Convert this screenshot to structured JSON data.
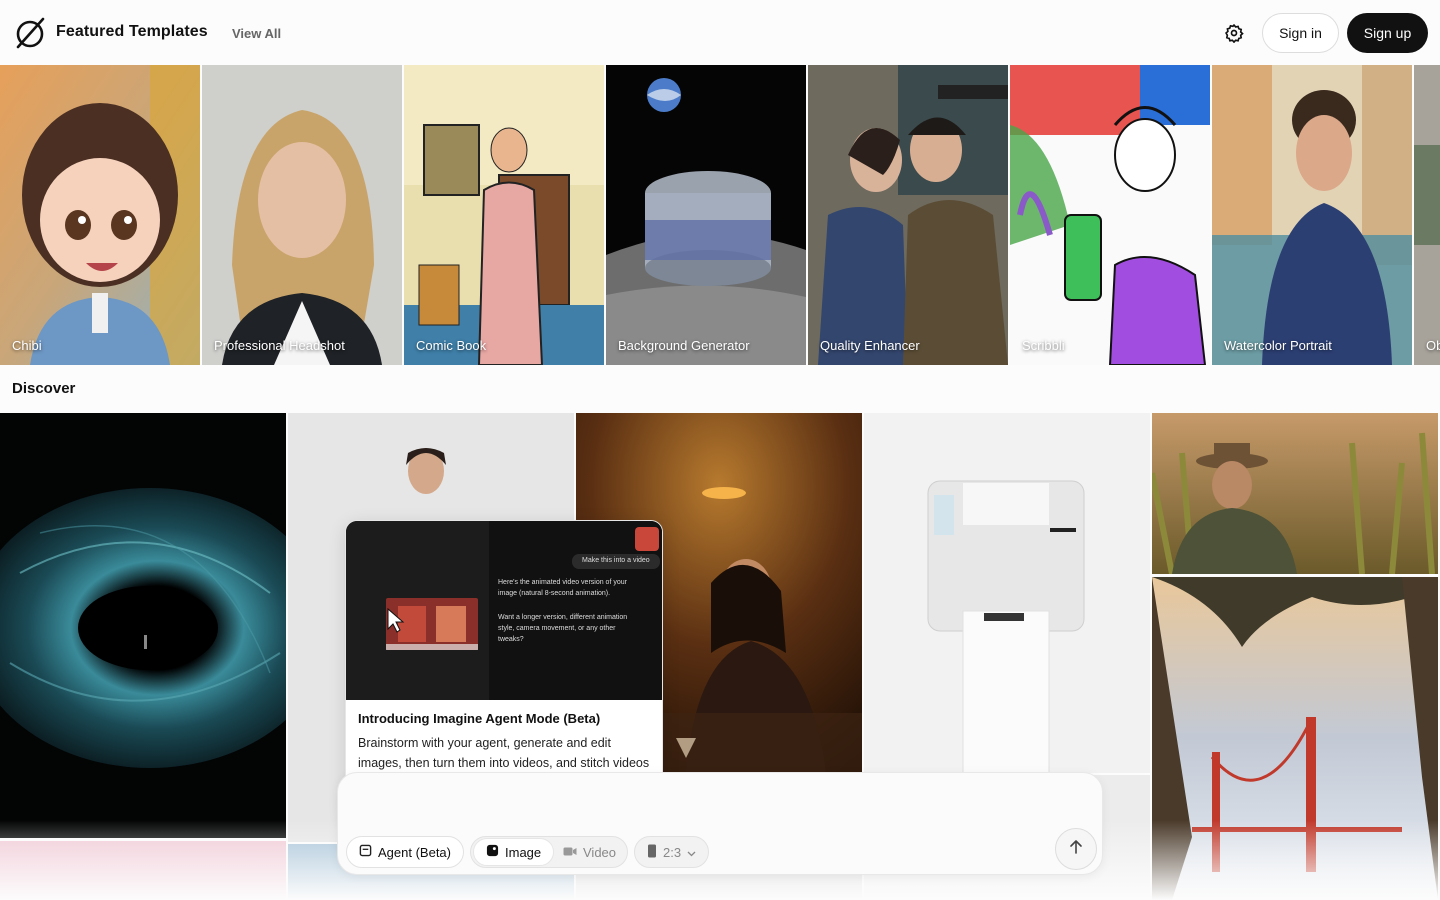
{
  "header": {
    "title": "Featured Templates",
    "view_all": "View All",
    "sign_in": "Sign in",
    "sign_up": "Sign up"
  },
  "templates": [
    {
      "label": "Chibi"
    },
    {
      "label": "Professional Headshot"
    },
    {
      "label": "Comic Book"
    },
    {
      "label": "Background Generator"
    },
    {
      "label": "Quality Enhancer"
    },
    {
      "label": "Scribbli"
    },
    {
      "label": "Watercolor Portrait"
    },
    {
      "label": "Ob"
    }
  ],
  "discover": {
    "heading": "Discover"
  },
  "promo": {
    "title": "Introducing Imagine Agent Mode (Beta)",
    "body": "Brainstorm with your agent, generate and edit images, then turn them into videos, and stitch videos together to create longer videos all in one place.",
    "chat_user": "Make this into a video",
    "chat_reply_1": "Here's the animated video version of your image (natural 8-second animation).",
    "chat_reply_2": "Want a longer version, different animation style, camera movement, or any other tweaks?"
  },
  "composer": {
    "agent_label": "Agent (Beta)",
    "image_label": "Image",
    "video_label": "Video",
    "ratio_label": "2:3"
  },
  "colors": {
    "accent": "#111111",
    "muted": "#666666"
  }
}
